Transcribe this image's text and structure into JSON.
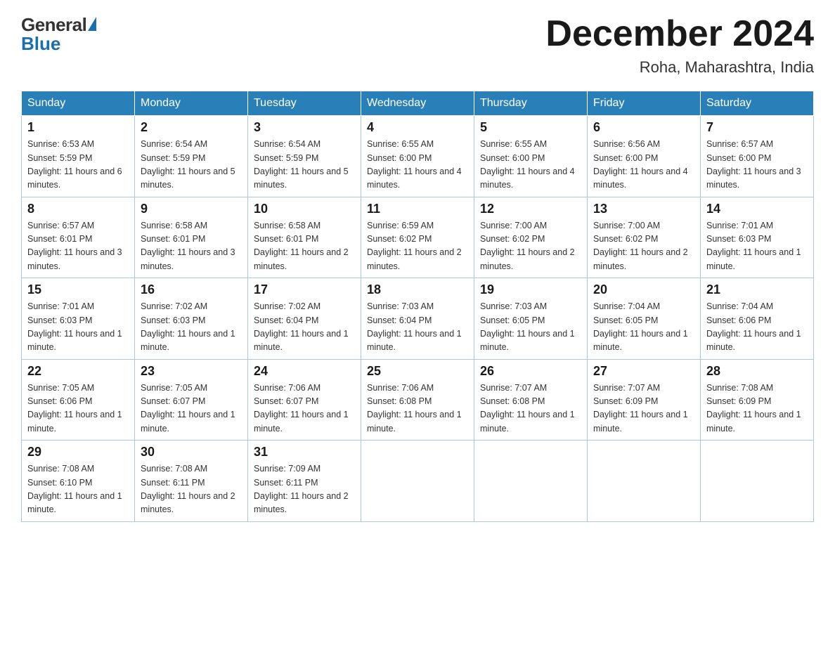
{
  "header": {
    "logo_general": "General",
    "logo_blue": "Blue",
    "title": "December 2024",
    "location": "Roha, Maharashtra, India"
  },
  "calendar": {
    "days_of_week": [
      "Sunday",
      "Monday",
      "Tuesday",
      "Wednesday",
      "Thursday",
      "Friday",
      "Saturday"
    ],
    "weeks": [
      [
        {
          "day": "1",
          "sunrise": "6:53 AM",
          "sunset": "5:59 PM",
          "daylight": "11 hours and 6 minutes."
        },
        {
          "day": "2",
          "sunrise": "6:54 AM",
          "sunset": "5:59 PM",
          "daylight": "11 hours and 5 minutes."
        },
        {
          "day": "3",
          "sunrise": "6:54 AM",
          "sunset": "5:59 PM",
          "daylight": "11 hours and 5 minutes."
        },
        {
          "day": "4",
          "sunrise": "6:55 AM",
          "sunset": "6:00 PM",
          "daylight": "11 hours and 4 minutes."
        },
        {
          "day": "5",
          "sunrise": "6:55 AM",
          "sunset": "6:00 PM",
          "daylight": "11 hours and 4 minutes."
        },
        {
          "day": "6",
          "sunrise": "6:56 AM",
          "sunset": "6:00 PM",
          "daylight": "11 hours and 4 minutes."
        },
        {
          "day": "7",
          "sunrise": "6:57 AM",
          "sunset": "6:00 PM",
          "daylight": "11 hours and 3 minutes."
        }
      ],
      [
        {
          "day": "8",
          "sunrise": "6:57 AM",
          "sunset": "6:01 PM",
          "daylight": "11 hours and 3 minutes."
        },
        {
          "day": "9",
          "sunrise": "6:58 AM",
          "sunset": "6:01 PM",
          "daylight": "11 hours and 3 minutes."
        },
        {
          "day": "10",
          "sunrise": "6:58 AM",
          "sunset": "6:01 PM",
          "daylight": "11 hours and 2 minutes."
        },
        {
          "day": "11",
          "sunrise": "6:59 AM",
          "sunset": "6:02 PM",
          "daylight": "11 hours and 2 minutes."
        },
        {
          "day": "12",
          "sunrise": "7:00 AM",
          "sunset": "6:02 PM",
          "daylight": "11 hours and 2 minutes."
        },
        {
          "day": "13",
          "sunrise": "7:00 AM",
          "sunset": "6:02 PM",
          "daylight": "11 hours and 2 minutes."
        },
        {
          "day": "14",
          "sunrise": "7:01 AM",
          "sunset": "6:03 PM",
          "daylight": "11 hours and 1 minute."
        }
      ],
      [
        {
          "day": "15",
          "sunrise": "7:01 AM",
          "sunset": "6:03 PM",
          "daylight": "11 hours and 1 minute."
        },
        {
          "day": "16",
          "sunrise": "7:02 AM",
          "sunset": "6:03 PM",
          "daylight": "11 hours and 1 minute."
        },
        {
          "day": "17",
          "sunrise": "7:02 AM",
          "sunset": "6:04 PM",
          "daylight": "11 hours and 1 minute."
        },
        {
          "day": "18",
          "sunrise": "7:03 AM",
          "sunset": "6:04 PM",
          "daylight": "11 hours and 1 minute."
        },
        {
          "day": "19",
          "sunrise": "7:03 AM",
          "sunset": "6:05 PM",
          "daylight": "11 hours and 1 minute."
        },
        {
          "day": "20",
          "sunrise": "7:04 AM",
          "sunset": "6:05 PM",
          "daylight": "11 hours and 1 minute."
        },
        {
          "day": "21",
          "sunrise": "7:04 AM",
          "sunset": "6:06 PM",
          "daylight": "11 hours and 1 minute."
        }
      ],
      [
        {
          "day": "22",
          "sunrise": "7:05 AM",
          "sunset": "6:06 PM",
          "daylight": "11 hours and 1 minute."
        },
        {
          "day": "23",
          "sunrise": "7:05 AM",
          "sunset": "6:07 PM",
          "daylight": "11 hours and 1 minute."
        },
        {
          "day": "24",
          "sunrise": "7:06 AM",
          "sunset": "6:07 PM",
          "daylight": "11 hours and 1 minute."
        },
        {
          "day": "25",
          "sunrise": "7:06 AM",
          "sunset": "6:08 PM",
          "daylight": "11 hours and 1 minute."
        },
        {
          "day": "26",
          "sunrise": "7:07 AM",
          "sunset": "6:08 PM",
          "daylight": "11 hours and 1 minute."
        },
        {
          "day": "27",
          "sunrise": "7:07 AM",
          "sunset": "6:09 PM",
          "daylight": "11 hours and 1 minute."
        },
        {
          "day": "28",
          "sunrise": "7:08 AM",
          "sunset": "6:09 PM",
          "daylight": "11 hours and 1 minute."
        }
      ],
      [
        {
          "day": "29",
          "sunrise": "7:08 AM",
          "sunset": "6:10 PM",
          "daylight": "11 hours and 1 minute."
        },
        {
          "day": "30",
          "sunrise": "7:08 AM",
          "sunset": "6:11 PM",
          "daylight": "11 hours and 2 minutes."
        },
        {
          "day": "31",
          "sunrise": "7:09 AM",
          "sunset": "6:11 PM",
          "daylight": "11 hours and 2 minutes."
        },
        null,
        null,
        null,
        null
      ]
    ]
  }
}
